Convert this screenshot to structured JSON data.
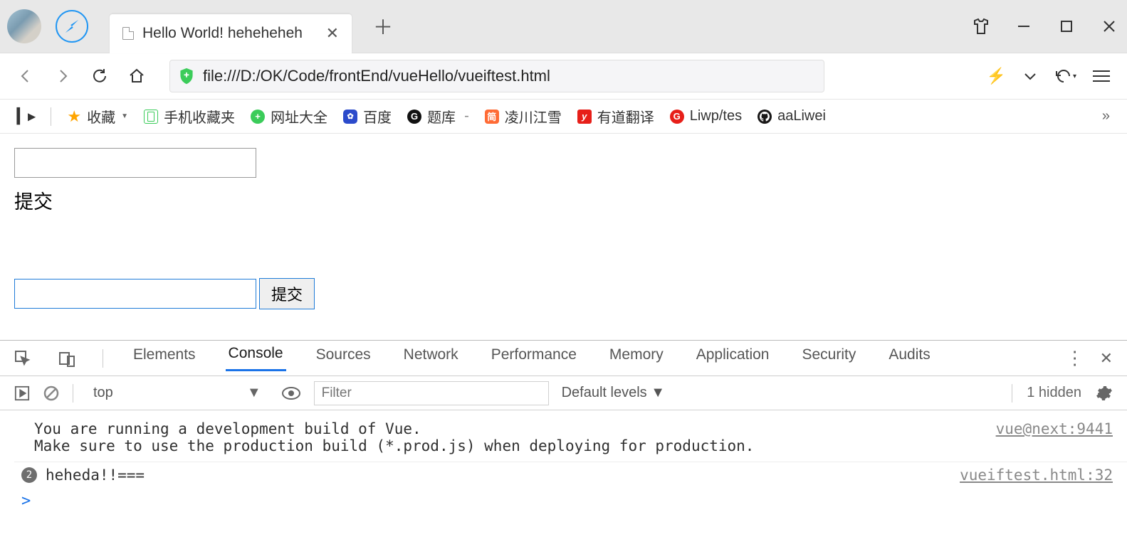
{
  "titlebar": {
    "tab_title": "Hello World! heheheheh"
  },
  "navbar": {
    "url": "file:///D:/OK/Code/frontEnd/vueHello/vueiftest.html"
  },
  "bookmarks": {
    "fav": "收藏",
    "mobile": "手机收藏夹",
    "site_nav": "网址大全",
    "baidu": "百度",
    "tiku": "题库",
    "lingchuan": "凌川江雪",
    "youdao": "有道翻译",
    "liwp": "Liwp/tes",
    "aaliwei": "aaLiwei",
    "tiku_dash": "-"
  },
  "content": {
    "label1": "提交",
    "button2": "提交"
  },
  "devtools": {
    "tabs": {
      "elements": "Elements",
      "console": "Console",
      "sources": "Sources",
      "network": "Network",
      "performance": "Performance",
      "memory": "Memory",
      "application": "Application",
      "security": "Security",
      "audits": "Audits"
    },
    "toolbar": {
      "context": "top",
      "filter_placeholder": "Filter",
      "levels": "Default levels ▼",
      "hidden": "1 hidden"
    },
    "console": {
      "msg1": "You are running a development build of Vue.\nMake sure to use the production build (*.prod.js) when deploying for production.",
      "src1": "vue@next:9441",
      "badge2": "2",
      "msg2": "heheda!!===",
      "src2": "vueiftest.html:32",
      "prompt": ">"
    }
  }
}
